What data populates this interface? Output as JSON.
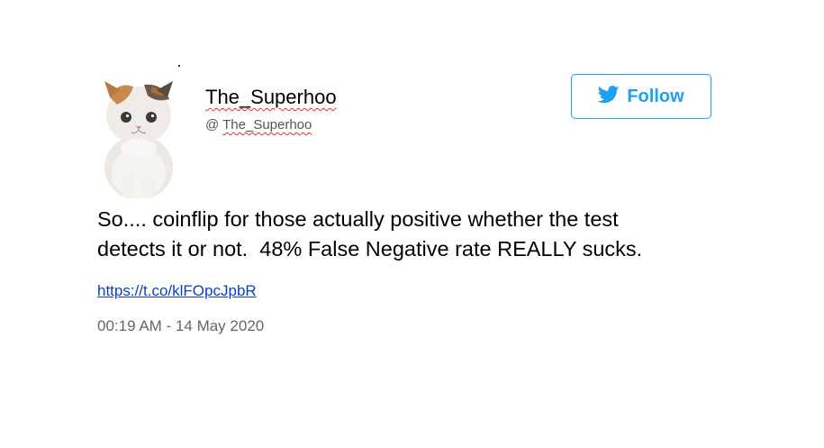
{
  "tweet": {
    "display_name": "The_Superhoo",
    "handle_prefix": "@ ",
    "handle": "The_Superhoo",
    "avatar_icon": "cat-avatar-icon",
    "follow_label": "Follow",
    "follow_icon": "twitter-bird-icon",
    "text_line1": "So.... coinflip for those actually positive whether the test",
    "text_line2": "detects it or not.  48% False Negative rate REALLY sucks.",
    "link": "https://t.co/klFOpcJpbR",
    "timestamp": "00:19 AM - 14 May 2020"
  },
  "colors": {
    "accent": "#1da1f2",
    "link": "#0b3fbf",
    "muted": "#666666",
    "spellcheck": "#e0302a"
  }
}
